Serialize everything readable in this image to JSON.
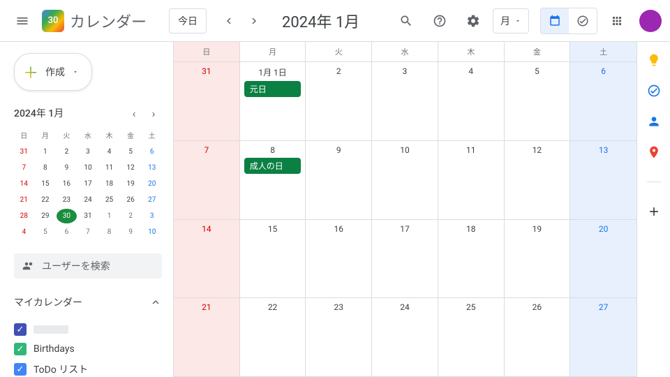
{
  "header": {
    "logo_day": "30",
    "app_name": "カレンダー",
    "today": "今日",
    "date_title": "2024年 1月",
    "view_label": "月"
  },
  "sidebar": {
    "create": "作成",
    "mini_title": "2024年 1月",
    "dow": [
      "日",
      "月",
      "火",
      "水",
      "木",
      "金",
      "土"
    ],
    "mini_days": [
      [
        {
          "n": "31",
          "cls": "other sun"
        },
        {
          "n": "1"
        },
        {
          "n": "2"
        },
        {
          "n": "3"
        },
        {
          "n": "4"
        },
        {
          "n": "5"
        },
        {
          "n": "6",
          "cls": "sat"
        }
      ],
      [
        {
          "n": "7",
          "cls": "sun"
        },
        {
          "n": "8"
        },
        {
          "n": "9"
        },
        {
          "n": "10"
        },
        {
          "n": "11"
        },
        {
          "n": "12"
        },
        {
          "n": "13",
          "cls": "sat"
        }
      ],
      [
        {
          "n": "14",
          "cls": "sun"
        },
        {
          "n": "15"
        },
        {
          "n": "16"
        },
        {
          "n": "17"
        },
        {
          "n": "18"
        },
        {
          "n": "19"
        },
        {
          "n": "20",
          "cls": "sat"
        }
      ],
      [
        {
          "n": "21",
          "cls": "sun"
        },
        {
          "n": "22"
        },
        {
          "n": "23"
        },
        {
          "n": "24"
        },
        {
          "n": "25"
        },
        {
          "n": "26"
        },
        {
          "n": "27",
          "cls": "sat"
        }
      ],
      [
        {
          "n": "28",
          "cls": "sun"
        },
        {
          "n": "29"
        },
        {
          "n": "30",
          "cls": "today"
        },
        {
          "n": "31"
        },
        {
          "n": "1",
          "cls": "other"
        },
        {
          "n": "2",
          "cls": "other"
        },
        {
          "n": "3",
          "cls": "other sat"
        }
      ],
      [
        {
          "n": "4",
          "cls": "other sun"
        },
        {
          "n": "5",
          "cls": "other"
        },
        {
          "n": "6",
          "cls": "other"
        },
        {
          "n": "7",
          "cls": "other"
        },
        {
          "n": "8",
          "cls": "other"
        },
        {
          "n": "9",
          "cls": "other"
        },
        {
          "n": "10",
          "cls": "other sat"
        }
      ]
    ],
    "search_people": "ユーザーを検索",
    "my_calendars": "マイカレンダー",
    "calendars": [
      {
        "label": "",
        "color": "#3f51b5"
      },
      {
        "label": "Birthdays",
        "color": "#33b679"
      },
      {
        "label": "ToDo リスト",
        "color": "#4285f4"
      }
    ]
  },
  "grid": {
    "dow": [
      "日",
      "月",
      "火",
      "水",
      "木",
      "金",
      "土"
    ],
    "weeks": [
      [
        {
          "n": "31",
          "cls": "sun",
          "other": true
        },
        {
          "n": "1月 1日",
          "events": [
            "元日"
          ]
        },
        {
          "n": "2"
        },
        {
          "n": "3"
        },
        {
          "n": "4"
        },
        {
          "n": "5"
        },
        {
          "n": "6",
          "cls": "sat"
        }
      ],
      [
        {
          "n": "7",
          "cls": "sun"
        },
        {
          "n": "8",
          "events": [
            "成人の日"
          ]
        },
        {
          "n": "9"
        },
        {
          "n": "10"
        },
        {
          "n": "11"
        },
        {
          "n": "12"
        },
        {
          "n": "13",
          "cls": "sat"
        }
      ],
      [
        {
          "n": "14",
          "cls": "sun"
        },
        {
          "n": "15"
        },
        {
          "n": "16"
        },
        {
          "n": "17"
        },
        {
          "n": "18"
        },
        {
          "n": "19"
        },
        {
          "n": "20",
          "cls": "sat"
        }
      ],
      [
        {
          "n": "21",
          "cls": "sun"
        },
        {
          "n": "22"
        },
        {
          "n": "23"
        },
        {
          "n": "24"
        },
        {
          "n": "25"
        },
        {
          "n": "26"
        },
        {
          "n": "27",
          "cls": "sat"
        }
      ]
    ]
  },
  "rightbar_icons": [
    "keep",
    "tasks",
    "contacts",
    "maps"
  ]
}
